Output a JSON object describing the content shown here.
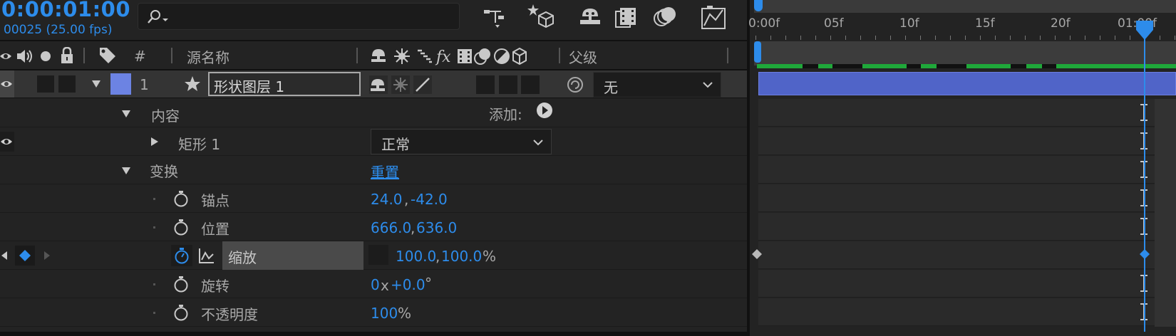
{
  "timecode": "0:00:01:00",
  "frame_info": "00025 (25.00 fps)",
  "search": {
    "placeholder": ""
  },
  "columns": {
    "number": "#",
    "source_name": "源名称",
    "parent": "父级"
  },
  "layer": {
    "number": "1",
    "name": "形状图层 1",
    "parent_value": "无",
    "label_color": "#6c83e3"
  },
  "content": {
    "label": "内容",
    "add_label": "添加:"
  },
  "rectangle": {
    "label": "矩形 1",
    "blend_mode": "正常"
  },
  "transform": {
    "label": "变换",
    "reset_label": "重置"
  },
  "properties": {
    "anchor": {
      "label": "锚点",
      "x": "24.0",
      "sep": ",",
      "y": "-42.0"
    },
    "position": {
      "label": "位置",
      "x": "666.0",
      "sep": ",",
      "y": "636.0"
    },
    "scale": {
      "label": "缩放",
      "x": "100.0",
      "sep": ",",
      "y": "100.0",
      "unit": "%"
    },
    "rotation": {
      "label": "旋转",
      "turns": "0",
      "times": "x",
      "degrees": "+0.0",
      "unit": "°"
    },
    "opacity": {
      "label": "不透明度",
      "value": "100",
      "unit": "%"
    }
  },
  "ruler": {
    "labels": [
      "0:00f",
      "05f",
      "10f",
      "15f",
      "20f",
      "01:00f"
    ]
  },
  "colors": {
    "accent": "#2d8ceb",
    "layer_bar": "#5064c8",
    "work_area": "#1fa83a"
  }
}
